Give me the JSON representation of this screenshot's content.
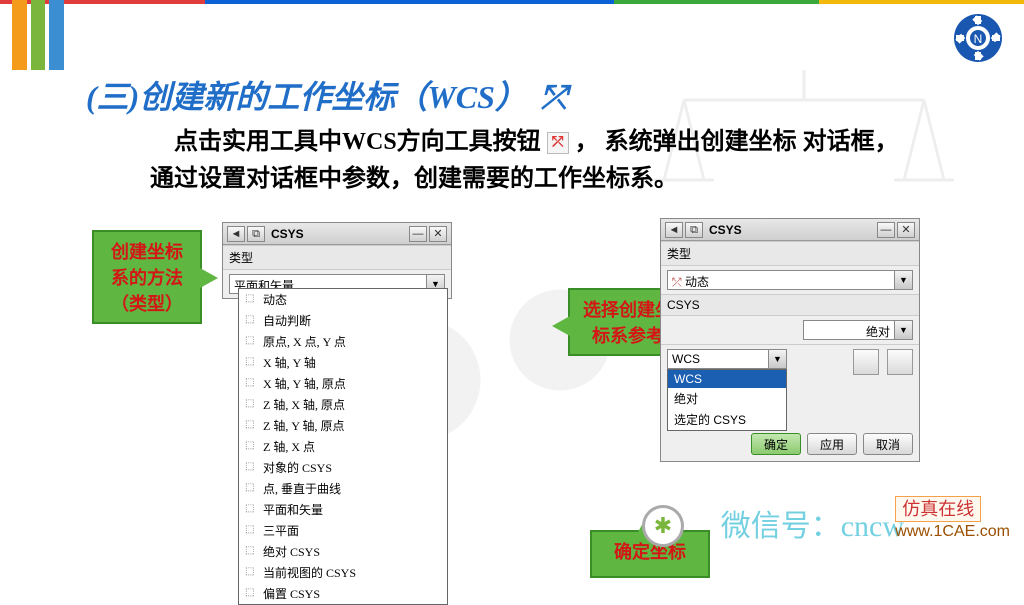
{
  "slide": {
    "title": "(三)创建新的工作坐标（WCS）",
    "body_1": "点击实用工具中WCS方向工具按钮",
    "body_2": "，  系统弹出创建坐标 对话框，通过设置对话框中参数，创建需要的工作坐标系。"
  },
  "callouts": {
    "left": {
      "l1": "创建坐标",
      "l2": "系的方法",
      "l3": "（类型）"
    },
    "mid": {
      "l1": "选择创建坐",
      "l2": "标系参考"
    },
    "bot": {
      "l1": "确定坐标"
    }
  },
  "dialog1": {
    "window": "CSYS",
    "section_type": "类型",
    "type_value": "平面和矢量",
    "options": [
      "动态",
      "自动判断",
      "原点, X 点, Y 点",
      "X 轴, Y 轴",
      "X 轴, Y 轴, 原点",
      "Z 轴, X 轴, 原点",
      "Z 轴, Y 轴, 原点",
      "Z 轴, X 点",
      "对象的 CSYS",
      "点, 垂直于曲线",
      "平面和矢量",
      "三平面",
      "绝对 CSYS",
      "当前视图的 CSYS",
      "偏置 CSYS"
    ]
  },
  "dialog2": {
    "window": "CSYS",
    "section_type": "类型",
    "type_value": "动态",
    "section_ref": "CSYS",
    "ref_value": "绝对",
    "wcs_value": "WCS",
    "wcs_options": [
      "WCS",
      "绝对",
      "选定的 CSYS"
    ],
    "btn_ok": "确定",
    "btn_apply": "应用",
    "btn_cancel": "取消"
  },
  "watermark": {
    "wechat": "微信号：cncw",
    "brand": "仿真在线",
    "url": "www.1CAE.com"
  }
}
